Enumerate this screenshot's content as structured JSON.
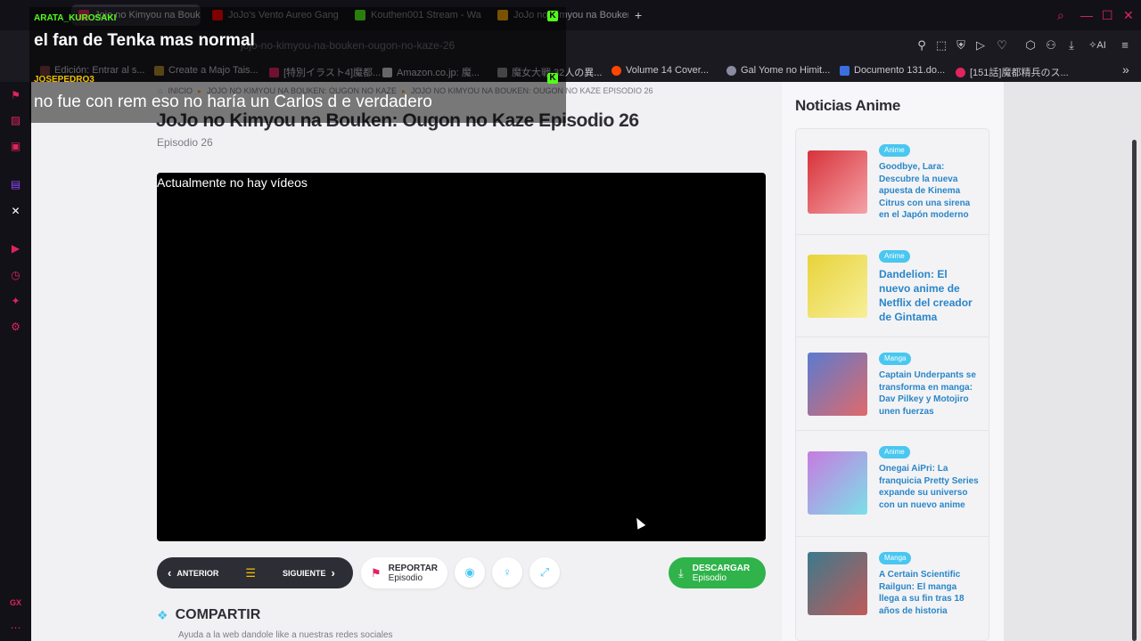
{
  "browser": {
    "tabs": [
      {
        "label": "Jojo no Kimyou na Bouken",
        "active": true,
        "fav": "#e0245e"
      },
      {
        "label": "JoJo's Vento Aureo Gang",
        "active": false,
        "fav": "#ff0000"
      },
      {
        "label": "Kouthen001 Stream - Wat",
        "active": false,
        "fav": "#53fc18"
      },
      {
        "label": "JoJo no Kimyou na Bouken",
        "active": false,
        "fav": "#f0a500"
      }
    ],
    "url": "jojo-no-kimyou-na-bouken-ougon-no-kaze-26",
    "new_tab": "+",
    "ai_label": "AI",
    "bookmarks": [
      {
        "label": "Edición: Entrar al s...",
        "fav": "#7a3b3b"
      },
      {
        "label": "Create a Majo Tais...",
        "fav": "#b08a2c"
      },
      {
        "label": "[特別イラスト4]魔都...",
        "fav": "#e0245e"
      },
      {
        "label": "Amazon.co.jp: 魔...",
        "fav": "#cccccc"
      },
      {
        "label": "魔女大戦 32人の異...",
        "fav": "#888888"
      },
      {
        "label": "Volume 14 Cover...",
        "fav": "#ff4500"
      },
      {
        "label": "Gal Yome no Himit...",
        "fav": "#8a8aa0"
      },
      {
        "label": "Documento 131.do...",
        "fav": "#3b6fe0"
      },
      {
        "label": "[151話]魔都精兵のス...",
        "fav": "#e0245e"
      }
    ],
    "bookmarks_more": "»"
  },
  "page": {
    "breadcrumb": [
      "INICIO",
      "JOJO NO KIMYOU NA BOUKEN: OUGON NO KAZE",
      "JOJO NO KIMYOU NA BOUKEN: OUGON NO KAZE EPISODIO 26"
    ],
    "title": "JoJo no Kimyou na Bouken: Ougon no Kaze Episodio 26",
    "subtitle": "Episodio 26",
    "player_message": "Actualmente no hay vídeos",
    "prev_label": "ANTERIOR",
    "next_label": "SIGUIENTE",
    "report_title": "REPORTAR",
    "report_sub": "Episodio",
    "download_title": "DESCARGAR",
    "download_sub": "Episodio",
    "share_title": "COMPARTIR",
    "share_sub": "Ayuda a la web dandole like a nuestras redes sociales"
  },
  "aside": {
    "title": "Noticias Anime",
    "news": [
      {
        "tag": "Anime",
        "title": "Goodbye, Lara: Descubre la nueva apuesta de Kinema Citrus con una sirena en el Japón moderno",
        "big": false,
        "thumb": "#d8323a"
      },
      {
        "tag": "Anime",
        "title": "Dandelion: El nuevo anime de Netflix del creador de Gintama",
        "big": true,
        "thumb": "#e8d33a"
      },
      {
        "tag": "Manga",
        "title": "Captain Underpants se transforma en manga: Dav Pilkey y Motojiro unen fuerzas",
        "big": false,
        "thumb": "#5a7bd0"
      },
      {
        "tag": "Anime",
        "title": "Onegai AiPri: La franquicia Pretty Series expande su universo con un nuevo anime",
        "big": false,
        "thumb": "#c77be0"
      },
      {
        "tag": "Manga",
        "title": "A Certain Scientific Railgun: El manga llega a su fin tras 18 años de historia",
        "big": false,
        "thumb": "#3c7a8c"
      }
    ]
  },
  "chat": [
    {
      "user": "ARATA_KUROSAKI",
      "color": "#53fc18",
      "message": "el fan de Tenka mas normal"
    },
    {
      "user": "JOSEPEDRO3",
      "color": "#f0c000",
      "message": "no fue con rem eso no haría un Carlos d e verdadero"
    }
  ],
  "sidebar_footer": "GX"
}
